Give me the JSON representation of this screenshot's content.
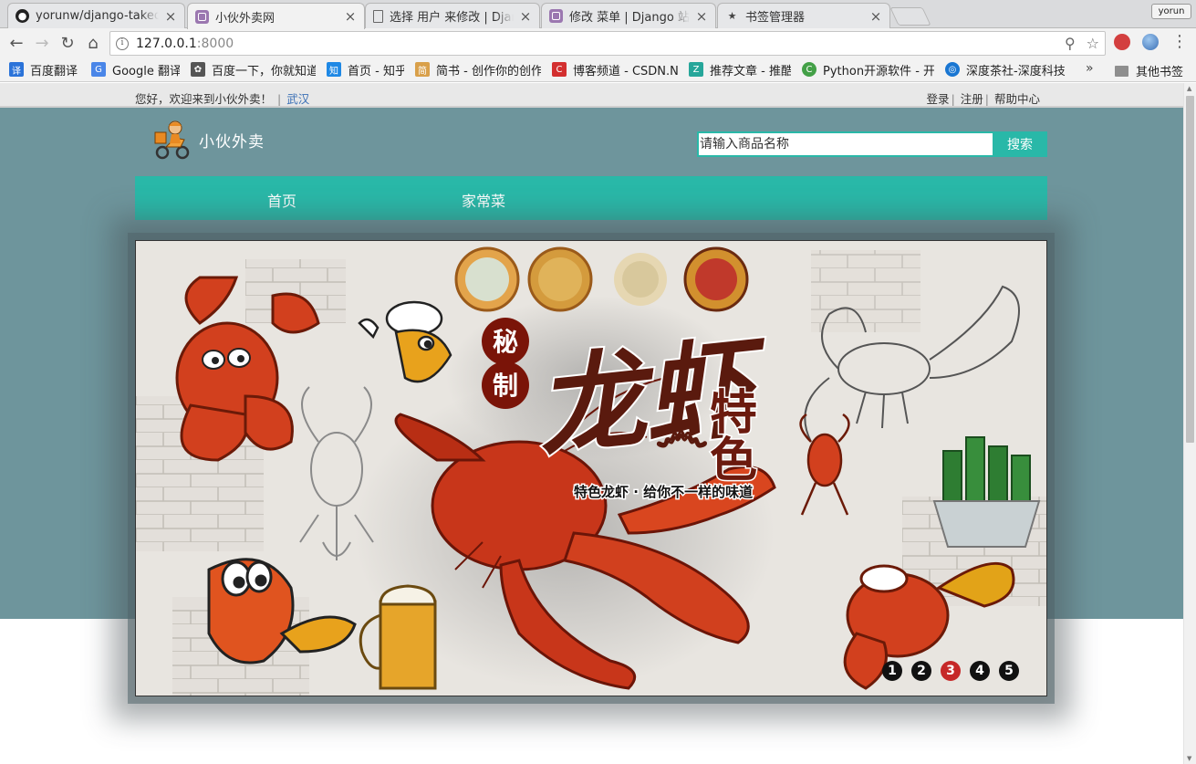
{
  "browser": {
    "tabs": [
      {
        "title": "yorunw/django-takeo",
        "icon": "github-icon"
      },
      {
        "title": "小伙外卖网",
        "icon": "django-admin-icon",
        "active": true
      },
      {
        "title": "选择 用户 来修改 | Djan",
        "icon": "document-icon"
      },
      {
        "title": "修改 菜单 | Django 站点",
        "icon": "django-admin-icon"
      },
      {
        "title": "书签管理器",
        "icon": "star-icon"
      }
    ],
    "profile": "yorun",
    "address": {
      "host": "127.0.0.1",
      "port": ":8000"
    },
    "bookmarks": [
      {
        "label": "百度翻译",
        "icon": "baidu-translate-icon",
        "icon_text": "译",
        "color": "#2b73d9"
      },
      {
        "label": "Google 翻译",
        "icon": "google-translate-icon",
        "icon_text": "G",
        "color": "#4a86e8"
      },
      {
        "label": "百度一下，你就知道",
        "icon": "baidu-paw-icon",
        "icon_text": "✿",
        "color": "#555555"
      },
      {
        "label": "首页 - 知乎",
        "icon": "zhihu-icon",
        "icon_text": "知",
        "color": "#1e88e5"
      },
      {
        "label": "简书 - 创作你的创作",
        "icon": "jianshu-icon",
        "icon_text": "简",
        "color": "#d9a04a"
      },
      {
        "label": "博客频道 - CSDN.NET",
        "icon": "csdn-icon",
        "icon_text": "C",
        "color": "#d32f2f"
      },
      {
        "label": "推荐文章 - 推酷",
        "icon": "tuicool-icon",
        "icon_text": "Z",
        "color": "#26a69a"
      },
      {
        "label": "Python开源软件 - 开",
        "icon": "oschina-icon",
        "icon_text": "C",
        "color": "#43a047"
      },
      {
        "label": "深度茶社-深度科技",
        "icon": "deepin-icon",
        "icon_text": "◎",
        "color": "#1976d2"
      }
    ],
    "bookmarks_overflow": "»",
    "other_bookmarks": "其他书签"
  },
  "page": {
    "topbar": {
      "welcome": "您好，欢迎来到小伙外卖！",
      "separator": "|",
      "city": "武汉",
      "login": "登录",
      "register": "注册",
      "help": "帮助中心",
      "pipe": "|"
    },
    "logo_text": "小伙外卖",
    "search": {
      "placeholder": "请输入商品名称",
      "button": "搜索"
    },
    "nav": [
      {
        "label": "首页"
      },
      {
        "label": "家常菜"
      }
    ],
    "banner": {
      "headline": "龙虾",
      "side_text": "特色",
      "stamp": [
        "秘",
        "制"
      ],
      "slogan": "特色龙虾 · 给你不一样的味道"
    },
    "carousel_dots": [
      "1",
      "2",
      "3",
      "4",
      "5"
    ],
    "carousel_active_index": 2
  },
  "colors": {
    "teal": "#29b8a8",
    "hero": "#6e959c",
    "active_dot": "#c62828"
  }
}
